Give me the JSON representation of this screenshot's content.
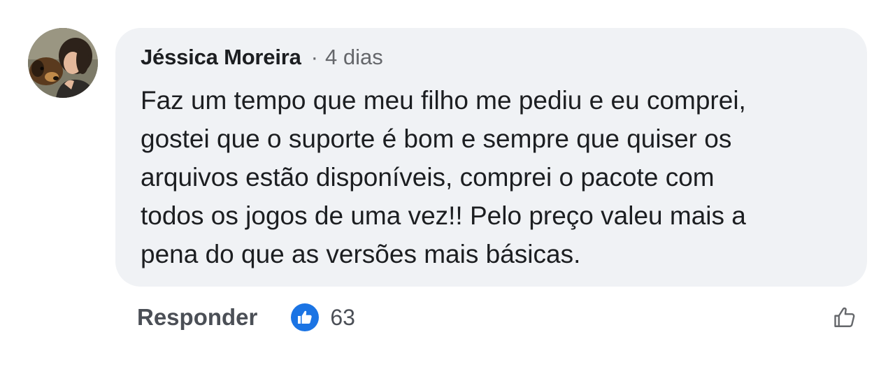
{
  "comment": {
    "author": "Jéssica Moreira",
    "separator": "·",
    "time": "4 dias",
    "text_lines": [
      "Faz um tempo que meu filho me pediu e eu comprei,",
      "gostei que o suporte é bom e sempre que quiser os",
      "arquivos estão disponíveis, comprei o pacote com",
      "todos os jogos de uma vez!! Pelo preço valeu mais a",
      "pena do que as versões mais básicas."
    ]
  },
  "actions": {
    "reply_label": "Responder",
    "reaction_icon": "thumbs-up-icon",
    "reaction_count": "63",
    "like_icon": "thumbs-up-outline-icon"
  },
  "colors": {
    "bubble_background": "#f0f2f5",
    "author_text": "#1c1e21",
    "meta_text": "#65676b",
    "reaction_blue": "#1b74e4"
  }
}
